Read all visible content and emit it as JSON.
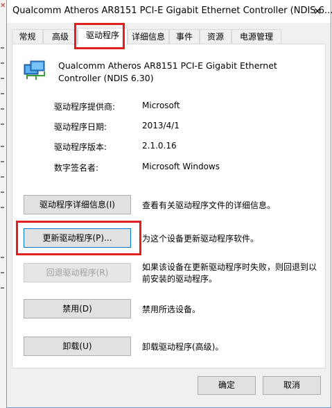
{
  "window": {
    "title": "Qualcomm Atheros AR8151 PCI-E Gigabit Ethernet Controller (NDIS 6....",
    "close_label": "✕"
  },
  "tabs": [
    {
      "label": "常规"
    },
    {
      "label": "高级"
    },
    {
      "label": "驱动程序"
    },
    {
      "label": "详细信息"
    },
    {
      "label": "事件"
    },
    {
      "label": "资源"
    },
    {
      "label": "电源管理"
    }
  ],
  "device": {
    "icon": "network-adapter-icon",
    "name": "Qualcomm Atheros AR8151 PCI-E Gigabit Ethernet Controller (NDIS 6.30)"
  },
  "info": [
    {
      "label": "驱动程序提供商:",
      "value": "Microsoft"
    },
    {
      "label": "驱动程序日期:",
      "value": "2013/4/1"
    },
    {
      "label": "驱动程序版本:",
      "value": "2.1.0.16"
    },
    {
      "label": "数字签名者:",
      "value": "Microsoft Windows"
    }
  ],
  "actions": [
    {
      "label": "驱动程序详细信息(I)",
      "desc": "查看有关驱动程序文件的详细信息。"
    },
    {
      "label": "更新驱动程序(P)...",
      "desc": "为这个设备更新驱动程序软件。"
    },
    {
      "label": "回退驱动程序(R)",
      "desc": "如果该设备在更新驱动程序时失败，则回退到以前安装的驱动程序。"
    },
    {
      "label": "禁用(D)",
      "desc": "禁用所选设备。"
    },
    {
      "label": "卸载(U)",
      "desc": "卸载驱动程序(高级)。"
    }
  ],
  "footer": {
    "ok_label": "确定",
    "cancel_label": "取消"
  },
  "colors": {
    "highlight": "#e0201f",
    "focus": "#0078d7",
    "dialog_bg": "#f0f0f0"
  }
}
